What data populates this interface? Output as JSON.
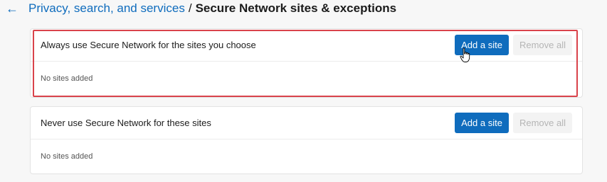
{
  "header": {
    "back_icon": "arrow-left-icon",
    "breadcrumb_link": "Privacy, search, and services",
    "separator": "/",
    "current_page": "Secure Network sites & exceptions"
  },
  "sections": [
    {
      "title": "Always use Secure Network for the sites you choose",
      "add_label": "Add a site",
      "remove_label": "Remove all",
      "empty_text": "No sites added"
    },
    {
      "title": "Never use Secure Network for these sites",
      "add_label": "Add a site",
      "remove_label": "Remove all",
      "empty_text": "No sites added"
    }
  ],
  "colors": {
    "accent": "#0f6cbd",
    "highlight": "#d9434b"
  }
}
